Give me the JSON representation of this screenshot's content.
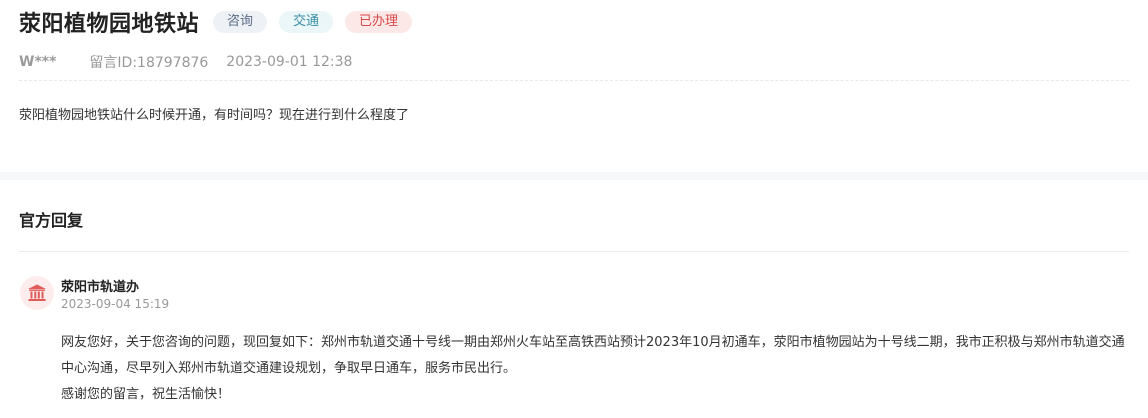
{
  "question": {
    "title": "荥阳植物园地铁站",
    "tags": {
      "consult": "咨询",
      "traffic": "交通",
      "status": "已办理"
    },
    "author": "W***",
    "message_id": "留言ID:18797876",
    "datetime": "2023-09-01 12:38",
    "content": "荥阳植物园地铁站什么时候开通，有时间吗？现在进行到什么程度了"
  },
  "reply": {
    "heading": "官方回复",
    "department": "荥阳市轨道办",
    "datetime": "2023-09-04 15:19",
    "paragraph1": "网友您好，关于您咨询的问题，现回复如下：郑州市轨道交通十号线一期由郑州火车站至高铁西站预计2023年10月初通车，荥阳市植物园站为十号线二期，我市正积极与郑州市轨道交通中心沟通，尽早列入郑州市轨道交通建设规划，争取早日通车，服务市民出行。",
    "paragraph2": "感谢您的留言，祝生活愉快！",
    "avatar_icon": "government-building-icon"
  },
  "colors": {
    "tag_consult_bg": "#eef2f7",
    "tag_traffic_bg": "#eaf6f8",
    "tag_done_bg": "#fde8e8",
    "tag_done_text": "#d84a4a",
    "avatar_accent": "#e05a5a",
    "section_gap": "#f6f7f9"
  }
}
